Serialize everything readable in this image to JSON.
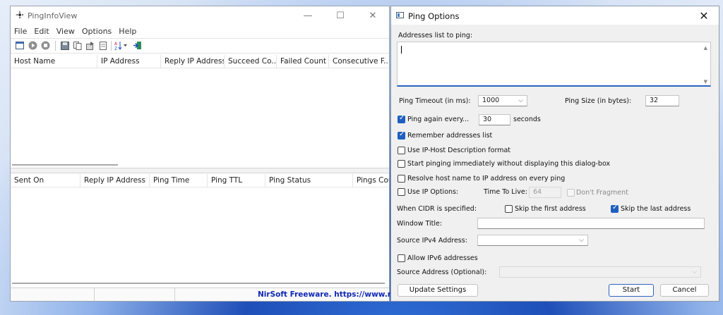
{
  "main_window": {
    "title": "PingInfoView",
    "controls": {
      "minimize": "—",
      "maximize": "☐",
      "close": "✕"
    },
    "menu": [
      "File",
      "Edit",
      "View",
      "Options",
      "Help"
    ],
    "toolbar_icons": [
      "properties-icon",
      "start-icon",
      "stop-icon",
      "save-icon",
      "copy-icon",
      "export-icon",
      "report-icon",
      "sort-icon",
      "exit-icon"
    ],
    "top_list_columns": [
      "Host Name",
      "IP Address",
      "Reply IP Address",
      "Succeed Co...",
      "Failed Count",
      "Consecutive F..."
    ],
    "bottom_list_columns": [
      "Sent On",
      "Reply IP Address",
      "Ping Time",
      "Ping TTL",
      "Ping Status",
      "Pings Cou"
    ],
    "status_text": "NirSoft Freeware. https://www.nirsoft.ne"
  },
  "dialog": {
    "title": "Ping Options",
    "close": "✕",
    "addresses_label": "Addresses list to ping:",
    "addresses_value": "",
    "timeout_label": "Ping Timeout (in ms):",
    "timeout_value": "1000",
    "size_label": "Ping Size (in bytes):",
    "size_value": "32",
    "ping_again_label": "Ping again every...",
    "ping_again_checked": true,
    "ping_again_value": "30",
    "seconds_label": "seconds",
    "remember_label": "Remember addresses list",
    "remember_checked": true,
    "ip_host_label": "Use IP-Host Description format",
    "ip_host_checked": false,
    "start_immediately_label": "Start pinging immediately without displaying this dialog-box",
    "start_immediately_checked": false,
    "resolve_label": "Resolve host name to IP address on every ping",
    "resolve_checked": false,
    "ip_options_label": "Use IP Options:",
    "ip_options_checked": false,
    "ttl_label": "Time To Live:",
    "ttl_value": "64",
    "dont_fragment_label": "Don't Fragment",
    "cidr_label": "When CIDR is specified:",
    "skip_first_label": "Skip the first address",
    "skip_first_checked": false,
    "skip_last_label": "Skip the last address",
    "skip_last_checked": true,
    "window_title_label": "Window Title:",
    "window_title_value": "",
    "source_ipv4_label": "Source IPv4 Address:",
    "source_ipv4_value": "",
    "allow_ipv6_label": "Allow IPv6 addresses",
    "allow_ipv6_checked": false,
    "source_address_label": "Source Address (Optional):",
    "source_address_value": "",
    "update_button": "Update Settings",
    "start_button": "Start",
    "cancel_button": "Cancel"
  },
  "colors": {
    "accent": "#1f5fbf",
    "link": "#1028b5"
  }
}
